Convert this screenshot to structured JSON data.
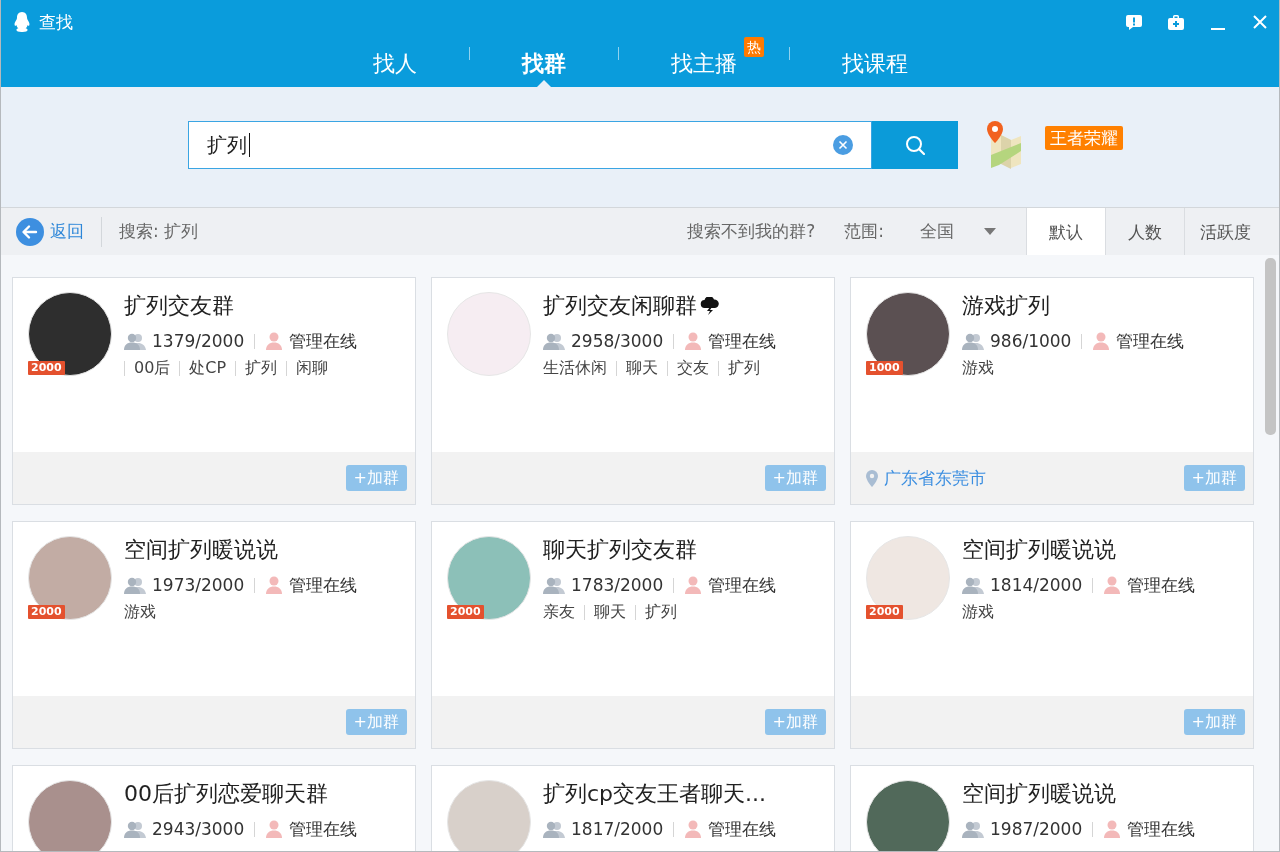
{
  "window": {
    "title": "查找"
  },
  "nav_tabs": [
    {
      "label": "找人",
      "selected": false
    },
    {
      "label": "找群",
      "selected": true
    },
    {
      "label": "找主播",
      "selected": false,
      "badge": "热"
    },
    {
      "label": "找课程",
      "selected": false
    }
  ],
  "search": {
    "value": "扩列",
    "hot_tag": "王者荣耀"
  },
  "toolbar": {
    "back": "返回",
    "query": "搜索: 扩列",
    "help_link": "搜索不到我的群?",
    "range_label": "范围:",
    "range_value": "全国",
    "sort_tabs": [
      {
        "label": "默认",
        "selected": true
      },
      {
        "label": "人数",
        "selected": false
      },
      {
        "label": "活跃度",
        "selected": false
      }
    ]
  },
  "groups": [
    {
      "name": "扩列交友群",
      "title_emoji": false,
      "badge": "2000",
      "members": "1379/2000",
      "admin_status": "管理在线",
      "leading_divider": true,
      "tags": [
        "00后",
        "处CP",
        "扩列",
        "闲聊"
      ],
      "join": "+加群"
    },
    {
      "name": "扩列交友闲聊群",
      "title_emoji": true,
      "members": "2958/3000",
      "admin_status": "管理在线",
      "leading_divider": false,
      "tags": [
        "生活休闲",
        "聊天",
        "交友",
        "扩列"
      ],
      "join": "+加群"
    },
    {
      "name": "游戏扩列",
      "title_emoji": false,
      "badge": "1000",
      "members": "986/1000",
      "admin_status": "管理在线",
      "leading_divider": false,
      "tags": [
        "游戏"
      ],
      "location": "广东省东莞市",
      "join": "+加群"
    },
    {
      "name": "空间扩列暖说说",
      "title_emoji": false,
      "badge": "2000",
      "members": "1973/2000",
      "admin_status": "管理在线",
      "leading_divider": false,
      "tags": [
        "游戏"
      ],
      "join": "+加群"
    },
    {
      "name": "聊天扩列交友群",
      "title_emoji": false,
      "badge": "2000",
      "members": "1783/2000",
      "admin_status": "管理在线",
      "leading_divider": false,
      "tags": [
        "亲友",
        "聊天",
        "扩列"
      ],
      "join": "+加群"
    },
    {
      "name": "空间扩列暖说说",
      "title_emoji": false,
      "badge": "2000",
      "members": "1814/2000",
      "admin_status": "管理在线",
      "leading_divider": false,
      "tags": [
        "游戏"
      ],
      "join": "+加群"
    },
    {
      "name": "00后扩列恋爱聊天群",
      "title_emoji": false,
      "members": "2943/3000",
      "admin_status": "管理在线"
    },
    {
      "name": "扩列cp交友王者聊天...",
      "title_emoji": false,
      "members": "1817/2000",
      "admin_status": "管理在线"
    },
    {
      "name": "空间扩列暖说说",
      "title_emoji": false,
      "members": "1987/2000",
      "admin_status": "管理在线"
    }
  ]
}
